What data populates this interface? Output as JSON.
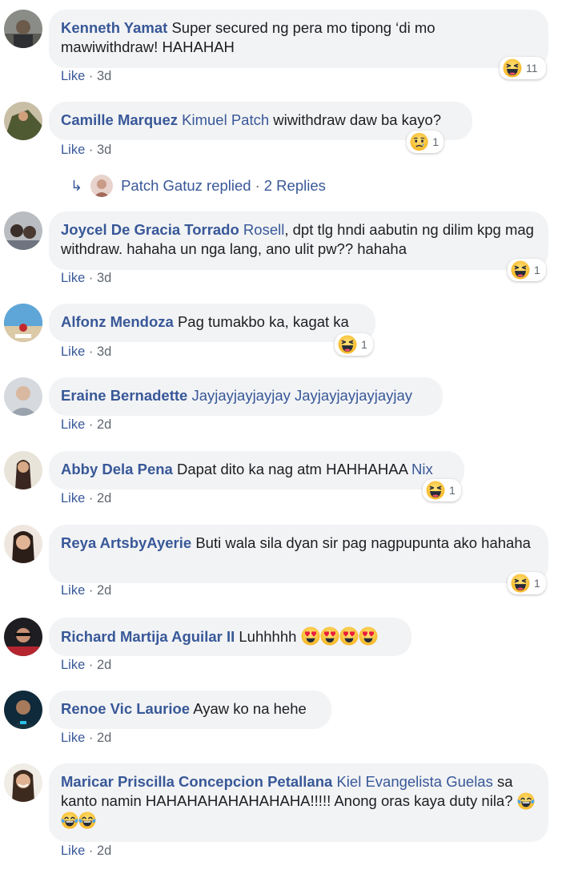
{
  "comments": [
    {
      "author": "Kenneth Yamat",
      "mention": "",
      "text": "Super secured ng pera mo tipong ‘di mo mawiwithdraw! HAHAHAH",
      "like": "Like",
      "time": "3d",
      "reaction": "haha",
      "reaction_count": "11"
    },
    {
      "author": "Camille Marquez",
      "mention": "Kimuel Patch",
      "text": "wiwithdraw daw ba kayo?",
      "like": "Like",
      "time": "3d",
      "reaction": "sad",
      "reaction_count": "1"
    },
    {
      "author": "Joycel De Gracia Torrado",
      "mention": "Rosell",
      "text": ", dpt tlg hndi aabutin ng dilim kpg mag withdraw. hahaha un nga lang, ano ulit pw?? hahaha",
      "like": "Like",
      "time": "3d",
      "reaction": "haha",
      "reaction_count": "1"
    },
    {
      "author": "Alfonz Mendoza",
      "mention": "",
      "text": "Pag tumakbo ka, kagat ka",
      "like": "Like",
      "time": "3d",
      "reaction": "haha",
      "reaction_count": "1"
    },
    {
      "author": "Eraine Bernadette",
      "mention": "Jayjayjayjayjay Jayjayjayjayjayjay",
      "text": "",
      "like": "Like",
      "time": "2d",
      "reaction": "",
      "reaction_count": ""
    },
    {
      "author": "Abby Dela Pena",
      "mention": "",
      "text": "Dapat dito ka nag atm HAHHAHAA",
      "trailing_mention": "Nix",
      "like": "Like",
      "time": "2d",
      "reaction": "haha",
      "reaction_count": "1"
    },
    {
      "author": "Reya ArtsbyAyerie",
      "mention": "",
      "text": "Buti wala sila dyan sir pag nagpupunta ako hahaha",
      "like": "Like",
      "time": "2d",
      "reaction": "haha",
      "reaction_count": "1"
    },
    {
      "author": "Richard Martija Aguilar II",
      "mention": "",
      "text": "Luhhhhh",
      "emojis": "heart-eyes x4",
      "like": "Like",
      "time": "2d",
      "reaction": "",
      "reaction_count": ""
    },
    {
      "author": "Renoe Vic Laurioe",
      "mention": "",
      "text": "Ayaw ko na hehe",
      "like": "Like",
      "time": "2d",
      "reaction": "",
      "reaction_count": ""
    },
    {
      "author": "Maricar Priscilla Concepcion Petallana",
      "mention": "Kiel Evangelista Guelas",
      "text": "sa kanto namin HAHAHAHAHAHAHAHA!!!!! Anong oras kaya duty nila?",
      "emojis": "tears-of-joy x3",
      "like": "Like",
      "time": "2d",
      "reaction": "",
      "reaction_count": ""
    }
  ],
  "replies_row": {
    "name": "Patch Gatuz replied",
    "sep": "·",
    "count": "2 Replies"
  },
  "separator": " · ",
  "colors": {
    "link": "#385898",
    "bubble": "#f2f3f5",
    "meta": "#606770"
  }
}
